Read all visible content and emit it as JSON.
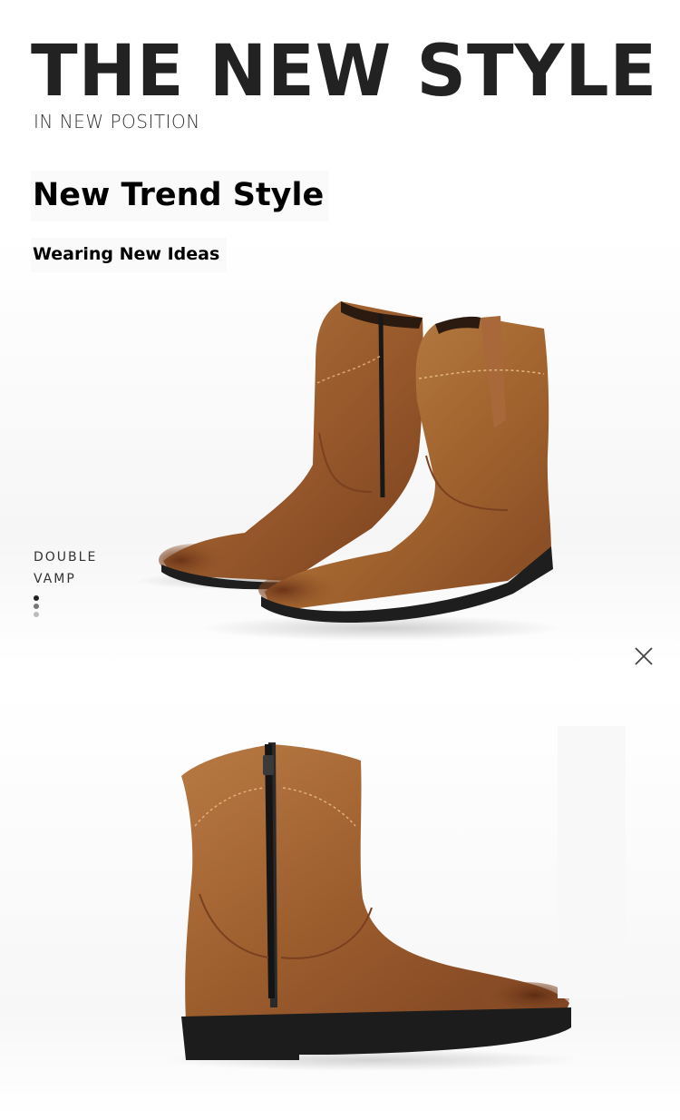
{
  "header": {
    "headline": "THE NEW STYLE",
    "subhead": "IN NEW POSITION"
  },
  "intro": {
    "title": "New Trend Style",
    "subtitle": "Wearing New Ideas"
  },
  "feature": {
    "label_line1": "DOUBLE",
    "label_line2": "VAMP"
  },
  "colors": {
    "leather": "#9a5a2a",
    "leather_light": "#b87a44",
    "sole": "#1e1e1e",
    "headline": "#222222"
  }
}
